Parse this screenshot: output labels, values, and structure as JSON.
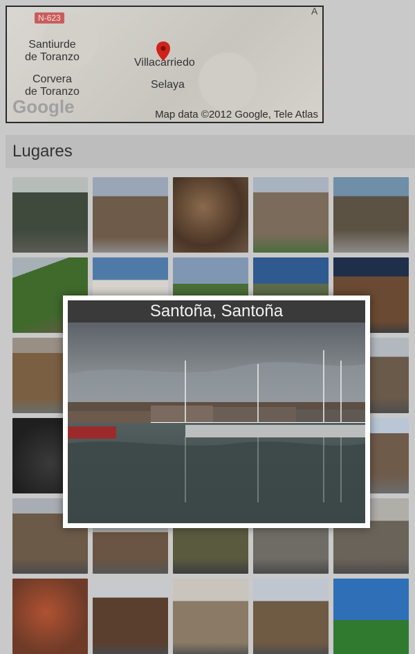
{
  "map": {
    "road_badge": "N-623",
    "labels": [
      {
        "text": "Santiurde\nde Toranzo"
      },
      {
        "text": "Corvera\nde Toranzo"
      },
      {
        "text": "Villacarriedo"
      },
      {
        "text": "Selaya"
      }
    ],
    "attribution": "Map data ©2012 Google, Tele Atlas",
    "google_text": "Google",
    "corner_glyph": "A"
  },
  "section": {
    "title": "Lugares"
  },
  "gallery": {
    "rows": 6,
    "cols": 5
  },
  "popup": {
    "title": "Santoña, Santoña"
  }
}
